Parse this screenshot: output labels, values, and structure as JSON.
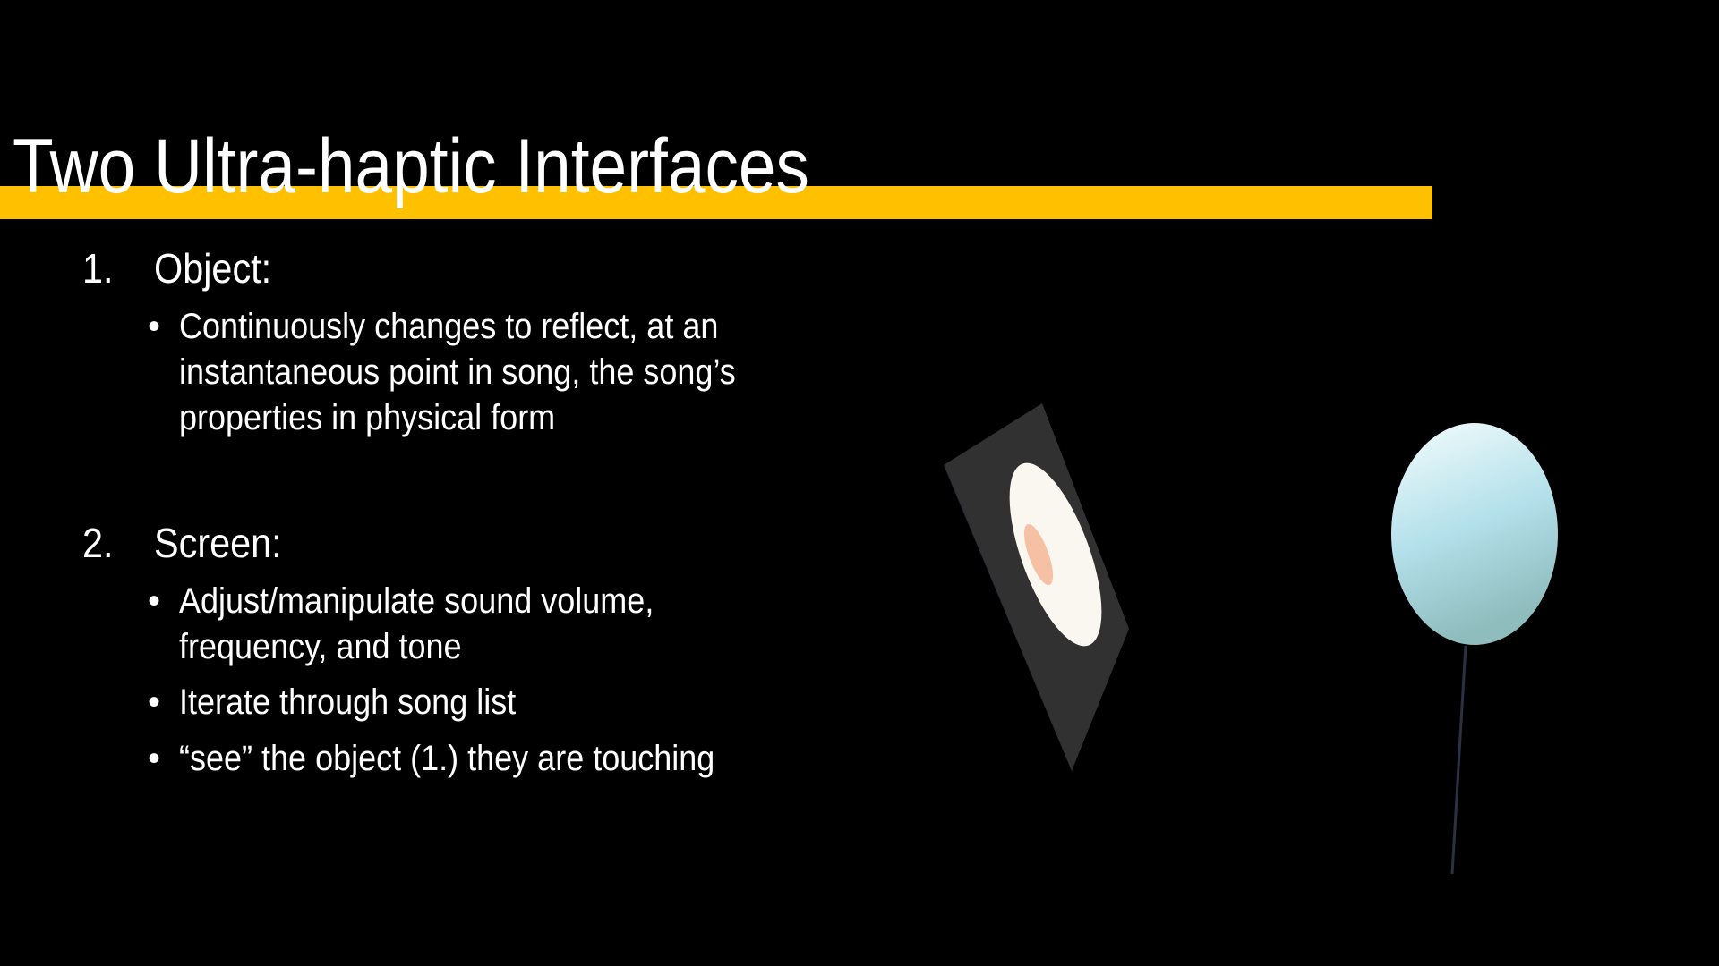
{
  "slide": {
    "title": "Two Ultra-haptic Interfaces",
    "accent_color": "#FFC000",
    "items": [
      {
        "number": "1.",
        "heading": "Object:",
        "bullets": [
          [
            "Continuously changes to reflect, at an",
            "instantaneous point in song, the song’s",
            "properties in physical form"
          ]
        ]
      },
      {
        "number": "2.",
        "heading": "Screen:",
        "bullets": [
          [
            "Adjust/manipulate sound volume,",
            "frequency, and tone"
          ],
          [
            "Iterate through song list"
          ],
          [
            "“see” the object (1.) they are touching"
          ]
        ]
      }
    ]
  }
}
